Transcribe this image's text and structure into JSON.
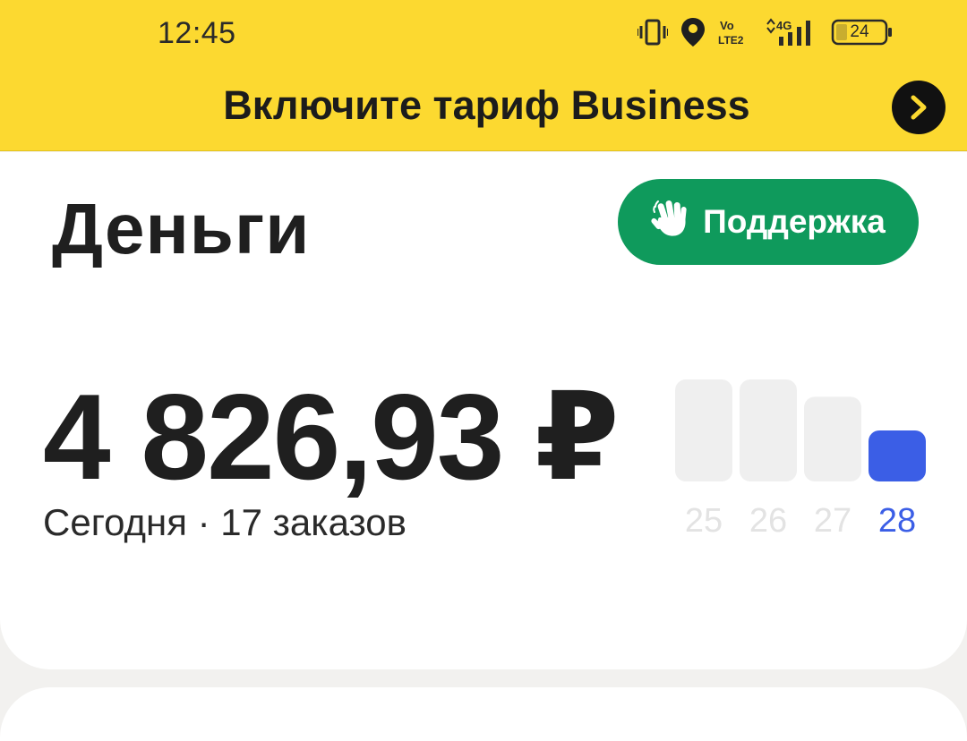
{
  "status_bar": {
    "time": "12:45",
    "battery_level": "24",
    "network": "4G",
    "volte": "Vo LTE2",
    "icons": [
      "vibrate-icon",
      "location-icon",
      "volte-icon",
      "signal-icon",
      "battery-icon"
    ]
  },
  "banner": {
    "text": "Включите тариф Business",
    "arrow_icon": "chevron-right-icon"
  },
  "header": {
    "title": "Деньги",
    "support_label": "Поддержка",
    "support_icon": "waving-hand-icon"
  },
  "earnings": {
    "amount": "4 826,93 ₽",
    "subtitle": "Сегодня · 17 заказов"
  },
  "colors": {
    "banner_yellow": "#fcd930",
    "support_green": "#0f9a5c",
    "bar_active": "#3b5ee6",
    "bar_inactive": "#efefef",
    "label_inactive": "#e3e3e3"
  },
  "chart_data": {
    "type": "bar",
    "categories": [
      "25",
      "26",
      "27",
      "28"
    ],
    "values": [
      1.0,
      1.0,
      0.83,
      0.5
    ],
    "value_unit": "relative height",
    "active_category": "28"
  }
}
